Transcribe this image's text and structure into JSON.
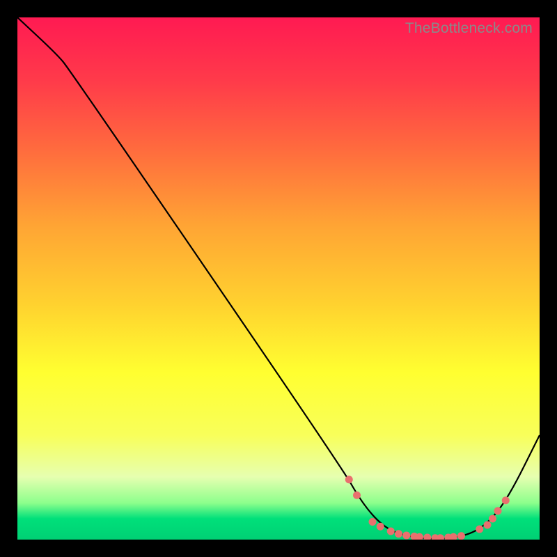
{
  "watermark": "TheBottleneck.com",
  "chart_data": {
    "type": "line",
    "title": "",
    "xlabel": "",
    "ylabel": "",
    "xlim": [
      0,
      100
    ],
    "ylim": [
      0,
      100
    ],
    "gradient_stops": [
      {
        "offset": 0.0,
        "color": "#ff1a52"
      },
      {
        "offset": 0.12,
        "color": "#ff3a4a"
      },
      {
        "offset": 0.25,
        "color": "#ff6a3e"
      },
      {
        "offset": 0.4,
        "color": "#ffa534"
      },
      {
        "offset": 0.55,
        "color": "#ffd22f"
      },
      {
        "offset": 0.68,
        "color": "#ffff30"
      },
      {
        "offset": 0.8,
        "color": "#f8ff5a"
      },
      {
        "offset": 0.88,
        "color": "#e6ffb0"
      },
      {
        "offset": 0.93,
        "color": "#8cff8c"
      },
      {
        "offset": 0.96,
        "color": "#00e07a"
      },
      {
        "offset": 1.0,
        "color": "#00d074"
      }
    ],
    "series": [
      {
        "name": "curve",
        "points": [
          {
            "x": 0.0,
            "y": 100.0
          },
          {
            "x": 7.5,
            "y": 93.0
          },
          {
            "x": 10.0,
            "y": 90.0
          },
          {
            "x": 62.0,
            "y": 14.0
          },
          {
            "x": 66.0,
            "y": 7.0
          },
          {
            "x": 70.0,
            "y": 2.5
          },
          {
            "x": 74.0,
            "y": 0.7
          },
          {
            "x": 80.0,
            "y": 0.0
          },
          {
            "x": 86.0,
            "y": 0.7
          },
          {
            "x": 90.0,
            "y": 3.0
          },
          {
            "x": 94.0,
            "y": 8.0
          },
          {
            "x": 100.0,
            "y": 20.0
          }
        ]
      }
    ],
    "markers": [
      {
        "x": 63.5,
        "y": 11.5
      },
      {
        "x": 65.0,
        "y": 8.5
      },
      {
        "x": 68.0,
        "y": 3.4
      },
      {
        "x": 69.5,
        "y": 2.5
      },
      {
        "x": 71.5,
        "y": 1.6
      },
      {
        "x": 73.0,
        "y": 1.1
      },
      {
        "x": 74.5,
        "y": 0.8
      },
      {
        "x": 76.0,
        "y": 0.6
      },
      {
        "x": 77.0,
        "y": 0.5
      },
      {
        "x": 78.5,
        "y": 0.4
      },
      {
        "x": 80.0,
        "y": 0.3
      },
      {
        "x": 81.0,
        "y": 0.3
      },
      {
        "x": 82.5,
        "y": 0.4
      },
      {
        "x": 83.5,
        "y": 0.5
      },
      {
        "x": 85.0,
        "y": 0.7
      },
      {
        "x": 88.5,
        "y": 2.0
      },
      {
        "x": 90.0,
        "y": 2.8
      },
      {
        "x": 91.0,
        "y": 4.0
      },
      {
        "x": 92.0,
        "y": 5.5
      },
      {
        "x": 93.5,
        "y": 7.5
      }
    ],
    "marker_color": "#e9706e",
    "line_color": "#000000"
  }
}
